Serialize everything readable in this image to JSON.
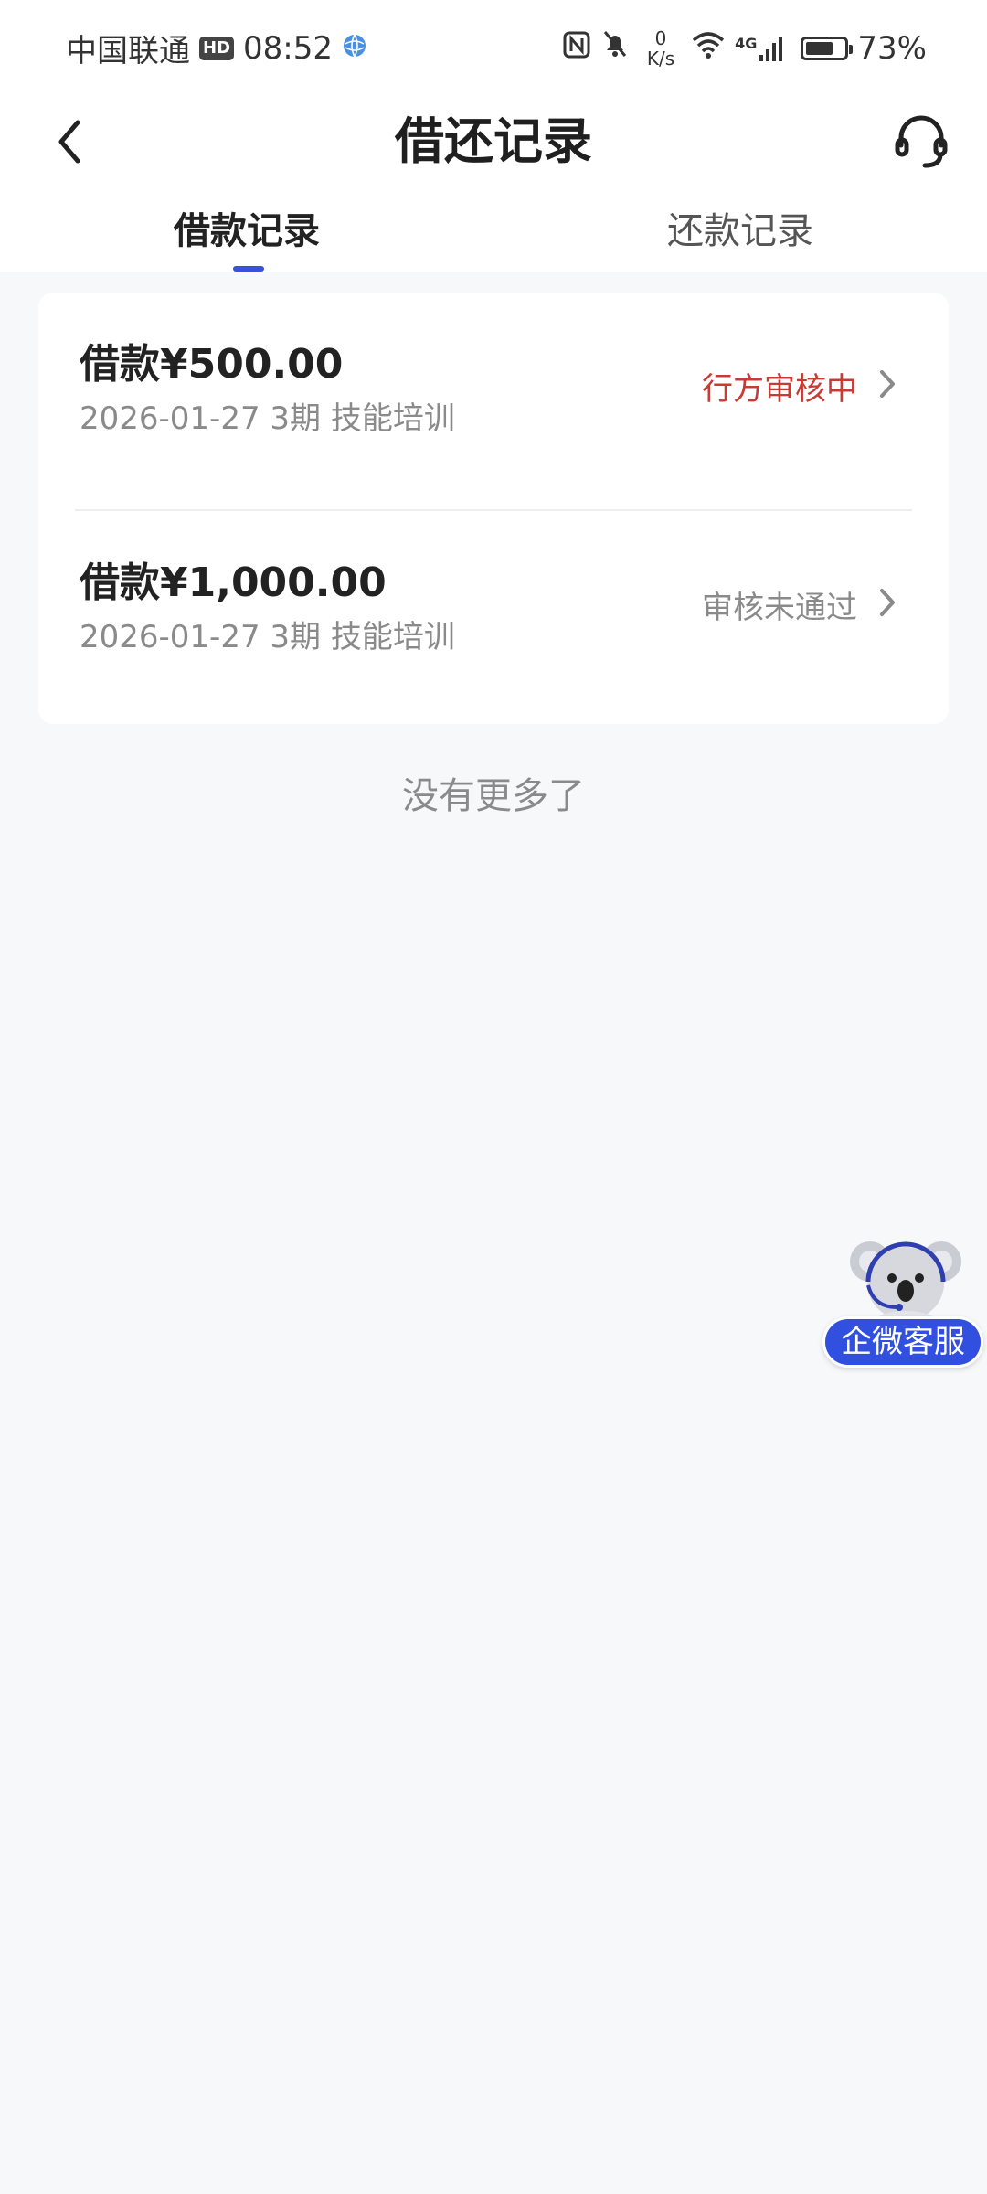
{
  "status_bar": {
    "carrier": "中国联通",
    "hd": "HD",
    "time": "08:52",
    "speed_value": "0",
    "speed_unit": "K/s",
    "network": "4G",
    "battery_percent": "73%",
    "battery_level": 0.73
  },
  "header": {
    "title": "借还记录",
    "back_icon": "chevron-left-icon",
    "support_icon": "headset-icon"
  },
  "tabs": [
    {
      "label": "借款记录",
      "active": true
    },
    {
      "label": "还款记录",
      "active": false
    }
  ],
  "records": [
    {
      "amount": "借款¥500.00",
      "meta": "2026-01-27 3期  技能培训",
      "status": "行方审核中",
      "status_color": "#c93a32"
    },
    {
      "amount": "借款¥1,000.00",
      "meta": "2026-01-27 3期  技能培训",
      "status": "审核未通过",
      "status_color": "#8a8a8a"
    }
  ],
  "list_footer": "没有更多了",
  "float_support": {
    "label": "企微客服",
    "icon": "koala-mascot-icon"
  },
  "colors": {
    "accent": "#3a52d9",
    "background": "#f7f8fa"
  }
}
